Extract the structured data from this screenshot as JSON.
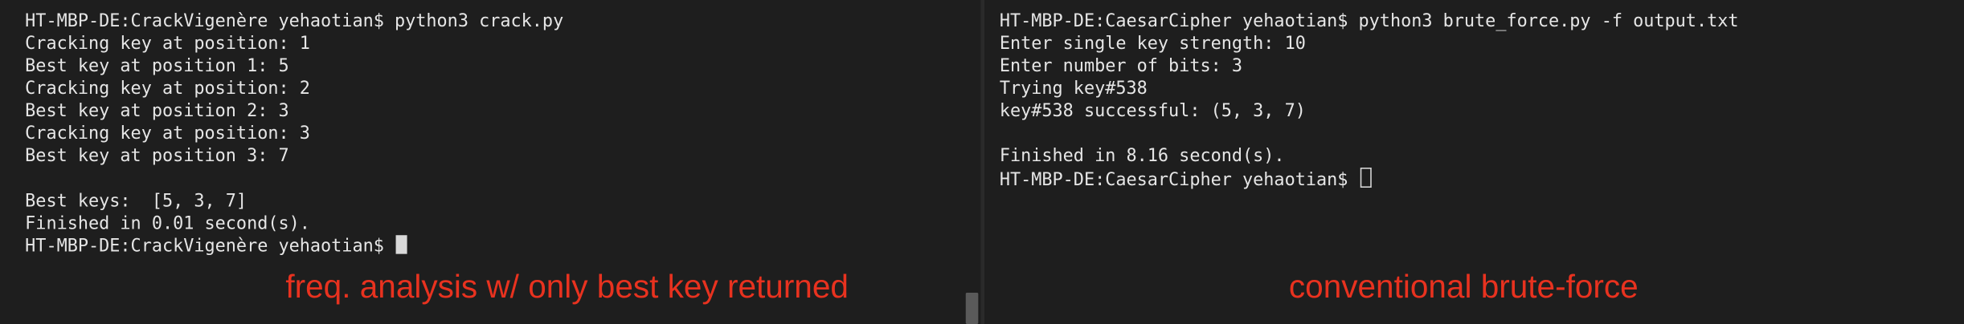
{
  "left_terminal": {
    "lines": [
      "HT-MBP-DE:CrackVigenère yehaotian$ python3 crack.py",
      "Cracking key at position: 1",
      "Best key at position 1: 5",
      "Cracking key at position: 2",
      "Best key at position 2: 3",
      "Cracking key at position: 3",
      "Best key at position 3: 7",
      "",
      "Best keys:  [5, 3, 7]",
      "Finished in 0.01 second(s)."
    ],
    "prompt": "HT-MBP-DE:CrackVigenère yehaotian$ ",
    "annotation": "freq. analysis w/ only best key returned"
  },
  "right_terminal": {
    "lines": [
      "HT-MBP-DE:CaesarCipher yehaotian$ python3 brute_force.py -f output.txt",
      "Enter single key strength: 10",
      "Enter number of bits: 3",
      "Trying key#538",
      "key#538 successful: (5, 3, 7)",
      "",
      "Finished in 8.16 second(s)."
    ],
    "prompt": "HT-MBP-DE:CaesarCipher yehaotian$ ",
    "annotation": "conventional brute-force"
  },
  "colors": {
    "background": "#1e1e1e",
    "text": "#e6e6e6",
    "annotation": "#e8321f",
    "cursor": "#d9d9d9"
  }
}
